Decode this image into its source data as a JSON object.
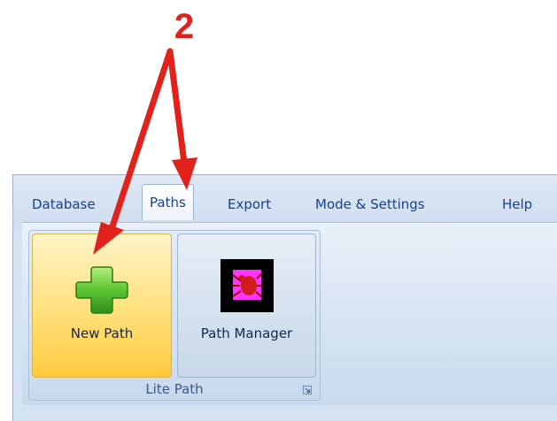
{
  "annotation": {
    "step_number": "2",
    "arrow_color": "#e0211c"
  },
  "ribbon": {
    "tabs": [
      {
        "label": "Database",
        "active": false
      },
      {
        "label": "Paths",
        "active": true
      },
      {
        "label": "Export",
        "active": false
      },
      {
        "label": "Mode & Settings",
        "active": false
      },
      {
        "label": "Help",
        "active": false
      }
    ],
    "group": {
      "label": "Lite Path",
      "buttons": [
        {
          "label": "New Path",
          "icon": "green-plus-icon",
          "state": "highlighted"
        },
        {
          "label": "Path Manager",
          "icon": "magenta-bug-icon",
          "state": "normal"
        }
      ]
    }
  },
  "colors": {
    "tab_text": "#15428b",
    "highlight": "#ffd966",
    "ribbon_background": "#d5e2f2"
  }
}
